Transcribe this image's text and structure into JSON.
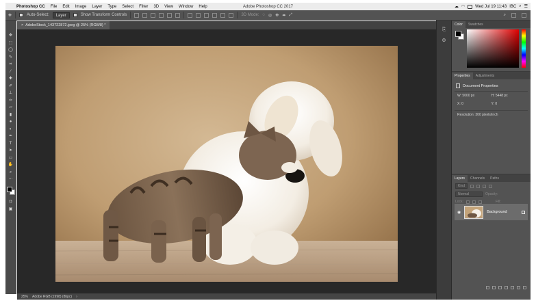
{
  "menubar": {
    "items": [
      "Photoshop CC",
      "File",
      "Edit",
      "Image",
      "Layer",
      "Type",
      "Select",
      "Filter",
      "3D",
      "View",
      "Window",
      "Help"
    ],
    "window_title": "Adobe Photoshop CC 2017",
    "clock": "Wed Jul 19  11:43",
    "user": "IBC"
  },
  "options_bar": {
    "auto_select_label": "Auto-Select:",
    "auto_select_value": "Layer",
    "transform_controls_label": "Show Transform Controls",
    "mode_label": "3D Mode:"
  },
  "document": {
    "tab_title": "AdobeStock_143722872.jpeg @ 25% (RGB/8) *",
    "zoom": "25%",
    "color_profile": "Adobe RGB (1998) (8bpc)"
  },
  "panels": {
    "color_tabs": [
      "Color",
      "Swatches"
    ],
    "props_tabs": [
      "Properties",
      "Adjustments"
    ],
    "props_title": "Document Properties",
    "width": "W: 5000 px",
    "height": "H: 5448 px",
    "x": "X: 0",
    "y": "Y: 0",
    "resolution": "Resolution: 300 pixels/inch",
    "layers_tabs": [
      "Layers",
      "Channels",
      "Paths"
    ],
    "kind_label": "Kind",
    "blend_mode": "Normal",
    "opacity_label": "Opacity:",
    "lock_label": "Lock:",
    "fill_label": "Fill:",
    "layer_name": "Background"
  },
  "colors": {
    "ui_dark": "#535353",
    "pasteboard": "#282828",
    "layer_selected": "#6c6c6c"
  }
}
